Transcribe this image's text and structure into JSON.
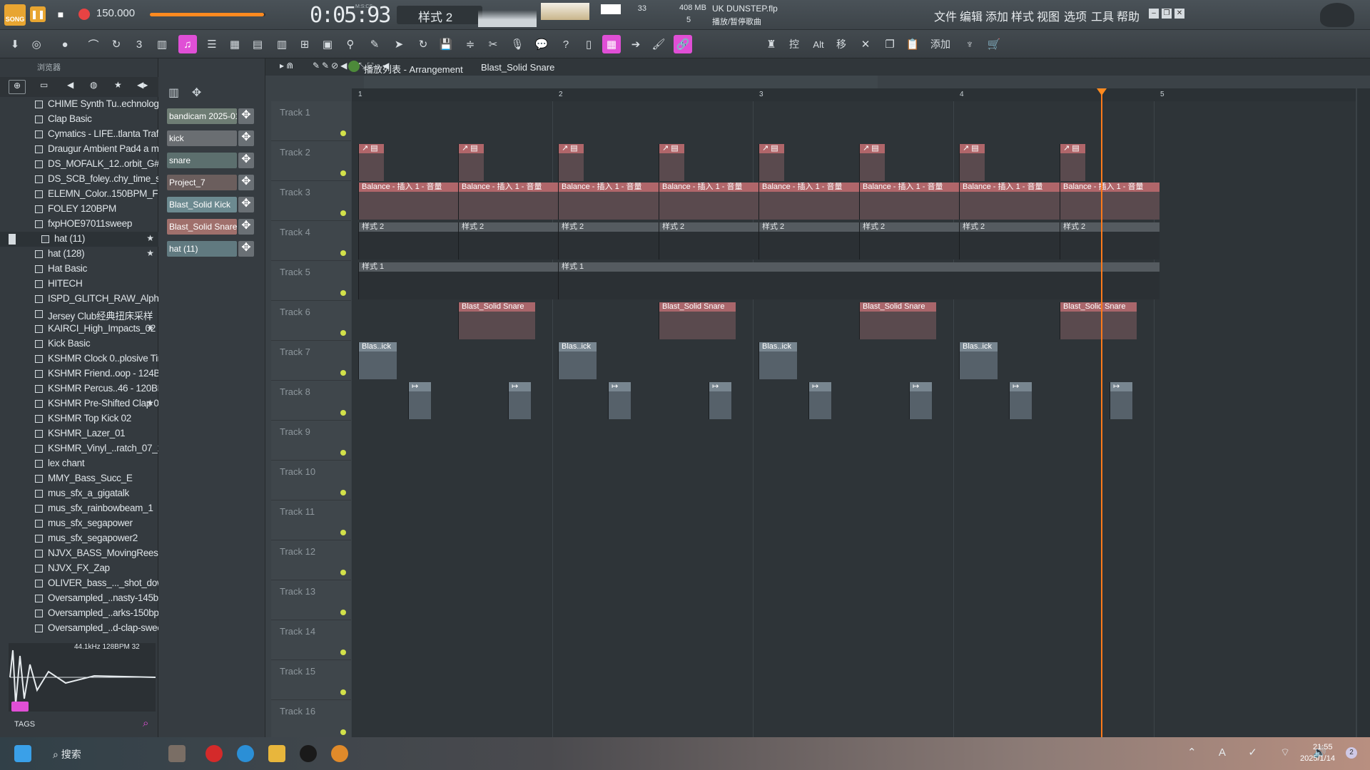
{
  "top": {
    "song_mode": "SONG",
    "tempo": "150.000",
    "time": "0:05:93",
    "time_unit": "M:S:CS",
    "pattern": "样式 2",
    "cpu_num": "33",
    "memory": "408 MB",
    "voices": "5",
    "project_name": "UK DUNSTEP.flp",
    "hint": "播放/暂停歌曲",
    "menu": [
      "文件",
      "编辑",
      "添加",
      "样式",
      "视图",
      "选项",
      "工具",
      "帮助"
    ],
    "snap": "线",
    "kbd_labels": {
      "ctrl": "控",
      "alt": "Alt",
      "move": "移",
      "add": "添加"
    }
  },
  "browser": {
    "title": "浏览器",
    "items": [
      {
        "label": "CHIME Synth Tu..echnology 01",
        "star": false
      },
      {
        "label": "Clap Basic",
        "star": false
      },
      {
        "label": "Cymatics - LIFE..tlanta Traffic 9",
        "star": false
      },
      {
        "label": "Draugur Ambient Pad4 a min",
        "star": false
      },
      {
        "label": "DS_MOFALK_12..orbit_G#min",
        "star": false
      },
      {
        "label": "DS_SCB_foley..chy_time_stop",
        "star": false
      },
      {
        "label": "ELEMN_Color..150BPM_Fmin",
        "star": false
      },
      {
        "label": "FOLEY 120BPM",
        "star": false
      },
      {
        "label": "fxpHOE97011sweep",
        "star": false
      },
      {
        "label": "hat (11)",
        "star": true
      },
      {
        "label": "hat (128)",
        "star": true
      },
      {
        "label": "Hat Basic",
        "star": false
      },
      {
        "label": "HITECH",
        "star": false
      },
      {
        "label": "ISPD_GLITCH_RAW_Alpha",
        "star": false
      },
      {
        "label": "Jersey Club经典扭床采样",
        "star": false
      },
      {
        "label": "KAIRCI_High_Impacts_02",
        "star": true
      },
      {
        "label": "Kick Basic",
        "star": false
      },
      {
        "label": "KSHMR Clock 0..plosive Timer",
        "star": false
      },
      {
        "label": "KSHMR Friend..oop - 124BPM",
        "star": false
      },
      {
        "label": "KSHMR Percus..46 - 120BPM",
        "star": false
      },
      {
        "label": "KSHMR Pre-Shifted Clap 09",
        "star": true
      },
      {
        "label": "KSHMR Top Kick 02",
        "star": false
      },
      {
        "label": "KSHMR_Lazer_01",
        "star": false
      },
      {
        "label": "KSHMR_Vinyl_..ratch_07_128",
        "star": false
      },
      {
        "label": "lex chant",
        "star": false
      },
      {
        "label": "MMY_Bass_Succ_E",
        "star": false
      },
      {
        "label": "mus_sfx_a_gigatalk",
        "star": false
      },
      {
        "label": "mus_sfx_rainbowbeam_1",
        "star": false
      },
      {
        "label": "mus_sfx_segapower",
        "star": false
      },
      {
        "label": "mus_sfx_segapower2",
        "star": false
      },
      {
        "label": "NJVX_BASS_MovingReese_B",
        "star": false
      },
      {
        "label": "NJVX_FX_Zap",
        "star": false
      },
      {
        "label": "OLIVER_bass_..._shot_down_F",
        "star": false
      },
      {
        "label": "Oversampled_..nasty-145bpm",
        "star": false
      },
      {
        "label": "Oversampled_..arks-150bpm",
        "star": false
      },
      {
        "label": "Oversampled_..d-clap-sweep",
        "star": false
      }
    ],
    "sample_info": "44.1kHz 128BPM 32",
    "tags": "TAGS"
  },
  "channels": [
    {
      "label": "bandicam 2025-01-1..",
      "color": "#6e7d74"
    },
    {
      "label": "kick",
      "color": "#6a6e72"
    },
    {
      "label": "snare",
      "color": "#5c6f6e"
    },
    {
      "label": "Project_7",
      "color": "#6b5e5d"
    },
    {
      "label": "Blast_Solid Kick",
      "color": "#6c8a90"
    },
    {
      "label": "Blast_Solid Snare",
      "color": "#a0706c"
    },
    {
      "label": "hat (11)",
      "color": "#617a80"
    }
  ],
  "playlist": {
    "breadcrumb": "播放列表 - Arrangement",
    "current": "Blast_Solid Snare",
    "bars": [
      "1",
      "2",
      "3",
      "4",
      "5"
    ],
    "tracks": [
      "Track 1",
      "Track 2",
      "Track 3",
      "Track 4",
      "Track 5",
      "Track 6",
      "Track 7",
      "Track 8",
      "Track 9",
      "Track 10",
      "Track 11",
      "Track 12",
      "Track 13",
      "Track 14",
      "Track 15",
      "Track 16"
    ],
    "auto_label": "Balance - 插入 1 - 音量",
    "pattern2": "样式 2",
    "pattern1": "样式 1",
    "snare_label": "Blast_Solid Snare",
    "kick_label": "Blas..ick"
  },
  "taskbar": {
    "search": "搜索",
    "time": "21:55",
    "date": "2025/1/14",
    "badge": "2",
    "ime": "A"
  }
}
